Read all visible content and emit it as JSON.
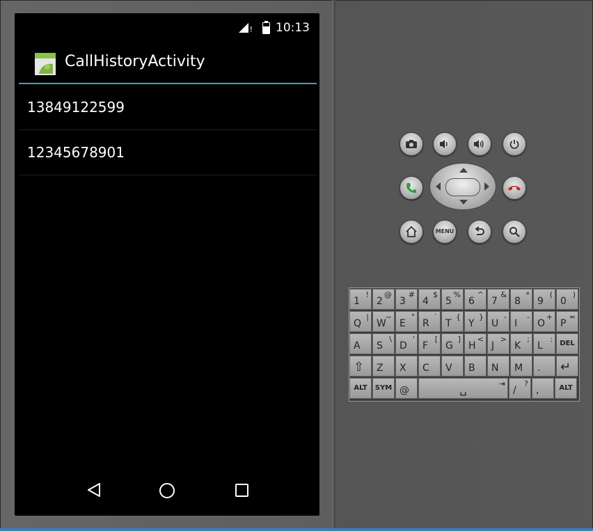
{
  "status_bar": {
    "time": "10:13"
  },
  "action_bar": {
    "title": "CallHistoryActivity"
  },
  "call_list": [
    {
      "number": "13849122599"
    },
    {
      "number": "12345678901"
    }
  ],
  "nav_bar": {
    "back": "◁"
  },
  "hardware": {
    "camera": "◘",
    "vol_down": "◂)",
    "vol_up": "◂))",
    "power": "⏻",
    "call": "✆",
    "end_call": "✆",
    "home": "⌂",
    "menu": "MENU",
    "back": "↶",
    "search": "⌕"
  },
  "colors": {
    "accent": "#33a5d6",
    "call_green": "#2e9e3a",
    "end_red": "#c62828"
  },
  "keyboard": {
    "rows": [
      [
        {
          "main": "1",
          "alt": "!"
        },
        {
          "main": "2",
          "alt": "@"
        },
        {
          "main": "3",
          "alt": "#"
        },
        {
          "main": "4",
          "alt": "$"
        },
        {
          "main": "5",
          "alt": "%"
        },
        {
          "main": "6",
          "alt": "^"
        },
        {
          "main": "7",
          "alt": "&"
        },
        {
          "main": "8",
          "alt": "*"
        },
        {
          "main": "9",
          "alt": "("
        },
        {
          "main": "0",
          "alt": ")"
        }
      ],
      [
        {
          "main": "Q",
          "alt": "|"
        },
        {
          "main": "W",
          "alt": "~"
        },
        {
          "main": "E",
          "alt": "\""
        },
        {
          "main": "R",
          "alt": "`"
        },
        {
          "main": "T",
          "alt": "{"
        },
        {
          "main": "Y",
          "alt": "}"
        },
        {
          "main": "U",
          "alt": "-"
        },
        {
          "main": "I",
          "alt": "-"
        },
        {
          "main": "O",
          "alt": "+"
        },
        {
          "main": "P",
          "alt": "="
        }
      ],
      [
        {
          "main": "A",
          "alt": ""
        },
        {
          "main": "S",
          "alt": "\\"
        },
        {
          "main": "D",
          "alt": "'"
        },
        {
          "main": "F",
          "alt": "["
        },
        {
          "main": "G",
          "alt": "]"
        },
        {
          "main": "H",
          "alt": "<"
        },
        {
          "main": "J",
          "alt": ">"
        },
        {
          "main": "K",
          "alt": ";"
        },
        {
          "main": "L",
          "alt": ":"
        },
        {
          "main": "DEL",
          "alt": ""
        }
      ],
      [
        {
          "main": "⇧",
          "alt": ""
        },
        {
          "main": "Z",
          "alt": ""
        },
        {
          "main": "X",
          "alt": ""
        },
        {
          "main": "C",
          "alt": ""
        },
        {
          "main": "V",
          "alt": ""
        },
        {
          "main": "B",
          "alt": ""
        },
        {
          "main": "N",
          "alt": ""
        },
        {
          "main": "M",
          "alt": ""
        },
        {
          "main": ".",
          "alt": ""
        },
        {
          "main": "↵",
          "alt": ""
        }
      ],
      [
        {
          "main": "ALT",
          "alt": ""
        },
        {
          "main": "SYM",
          "alt": ""
        },
        {
          "main": "@",
          "alt": ""
        },
        {
          "main": "␣",
          "alt": "⇥"
        },
        {
          "main": "/",
          "alt": "?"
        },
        {
          "main": ",",
          "alt": ""
        },
        {
          "main": "ALT",
          "alt": ""
        }
      ]
    ]
  }
}
